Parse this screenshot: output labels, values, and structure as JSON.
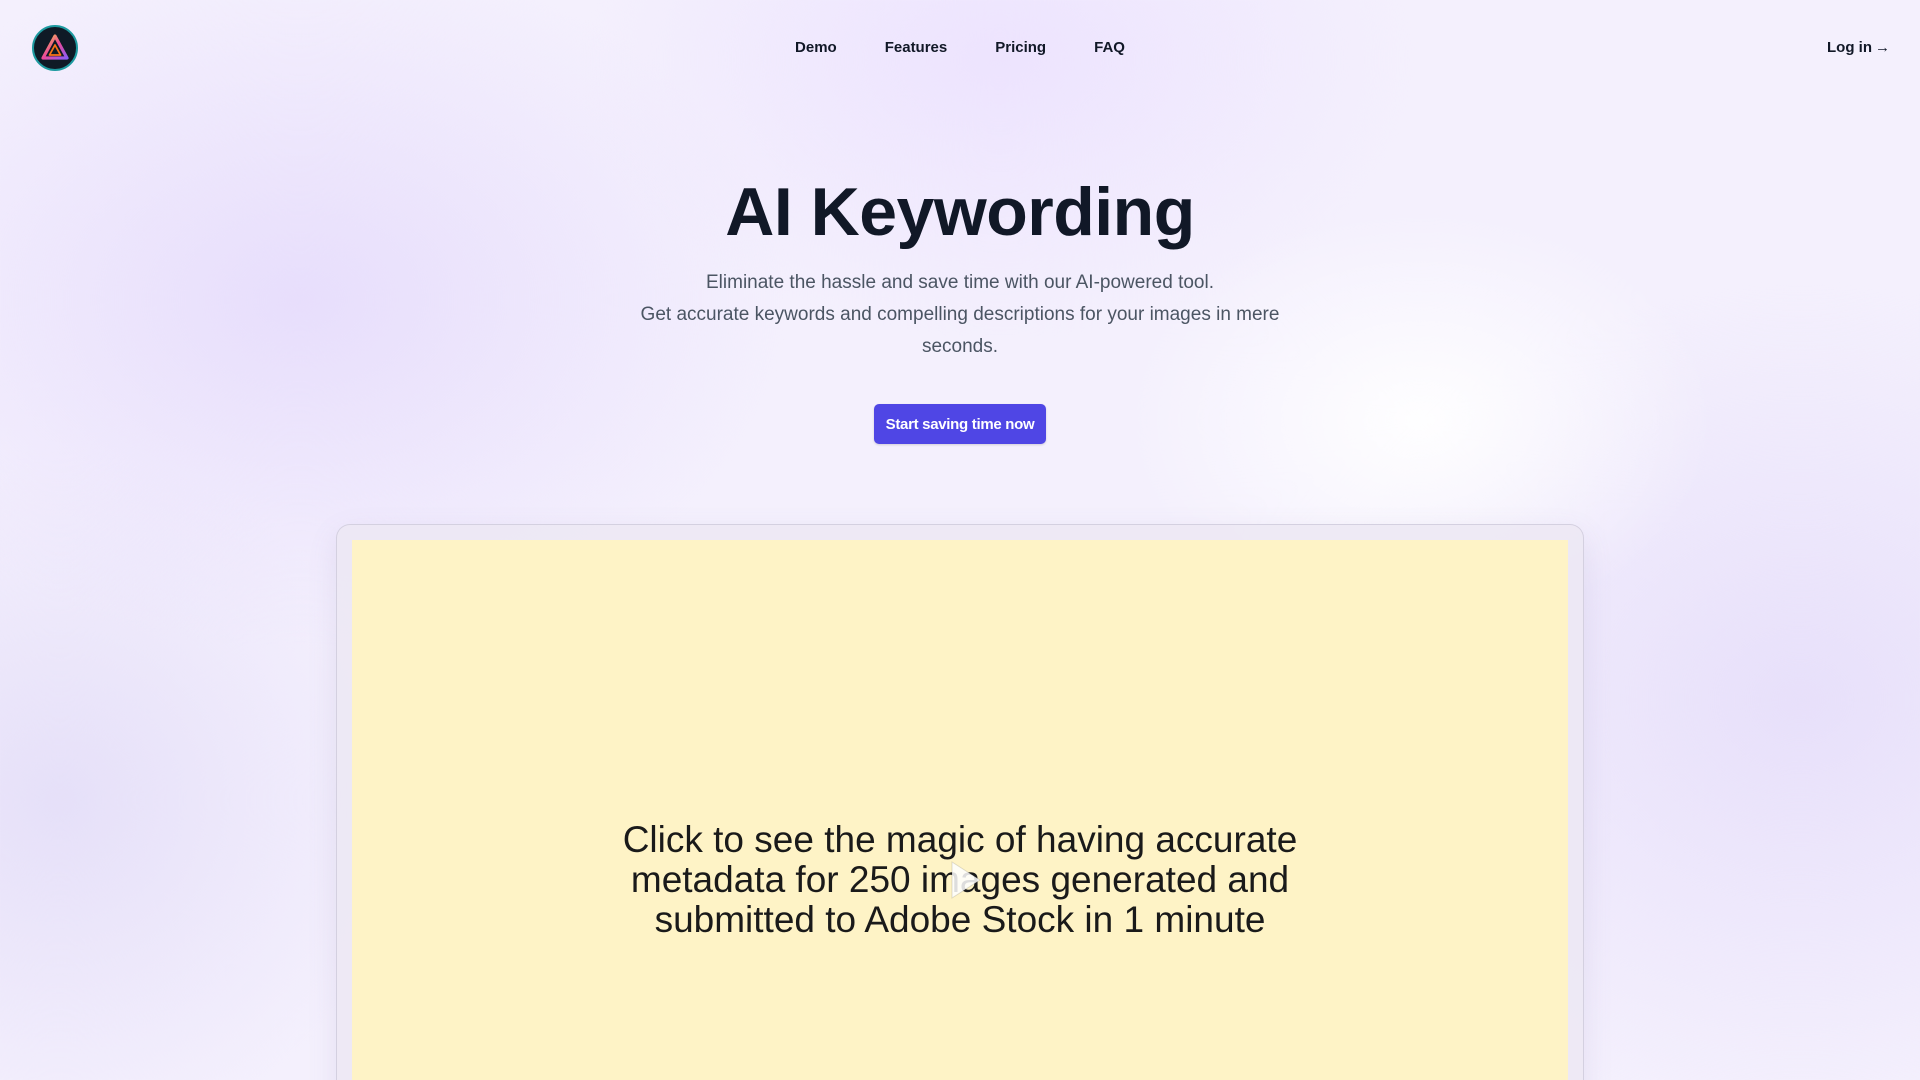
{
  "header": {
    "logo_alt": "logo",
    "nav": [
      {
        "label": "Demo"
      },
      {
        "label": "Features"
      },
      {
        "label": "Pricing"
      },
      {
        "label": "FAQ"
      }
    ],
    "login_label": "Log in",
    "login_arrow": "→"
  },
  "hero": {
    "title": "AI Keywording",
    "subtitle_line1": "Eliminate the hassle and save time with our AI-powered tool.",
    "subtitle_line2": "Get accurate keywords and compelling descriptions for your images in mere seconds.",
    "cta_label": "Start saving time now"
  },
  "demo": {
    "video_caption": "Click to see the magic of having accurate metadata for 250 images generated and submitted to Adobe Stock in 1 minute",
    "play_icon": "play-icon"
  },
  "colors": {
    "accent": "#4f46e5",
    "video_background": "#fef3c6",
    "page_background": "#f4f0fd",
    "text_dark": "#111827",
    "text_muted": "#4b5563"
  }
}
